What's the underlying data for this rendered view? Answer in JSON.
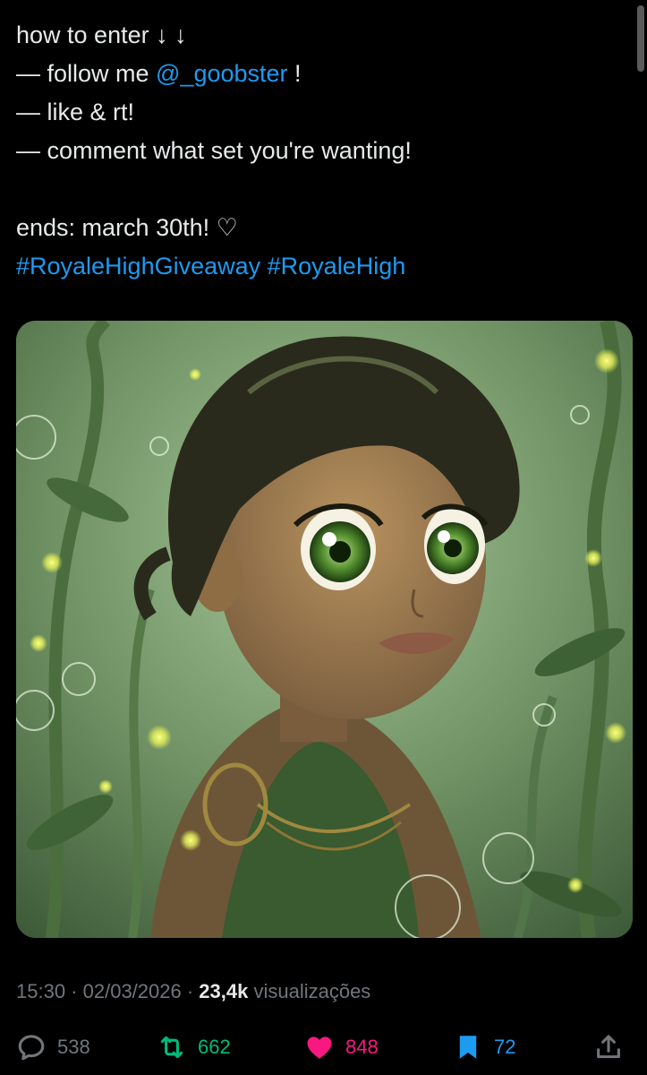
{
  "post": {
    "lines": [
      "how to enter ↓ ↓",
      "— follow me ",
      " !",
      "— like & rt!",
      "— comment what set you're wanting!",
      "ends: march 30th! ♡",
      " "
    ],
    "mention": "@_goobster",
    "hashtags": [
      "#RoyaleHighGiveaway",
      "#RoyaleHigh"
    ]
  },
  "meta": {
    "time": "15:30",
    "date": "02/03/2026",
    "separator": " · ",
    "views_count": "23,4k",
    "views_label": " visualizações"
  },
  "actions": {
    "replies": "538",
    "retweets": "662",
    "likes": "848",
    "bookmarks": "72"
  },
  "colors": {
    "link": "#1d9bf0",
    "retweet": "#00ba7c",
    "like": "#f91880",
    "bookmark": "#1d9bf0",
    "muted": "#71767b"
  },
  "icons": {
    "reply": "reply-bubble-icon",
    "retweet": "retweet-arrows-icon",
    "like": "heart-filled-icon",
    "bookmark": "bookmark-filled-icon",
    "share": "share-upload-icon"
  }
}
